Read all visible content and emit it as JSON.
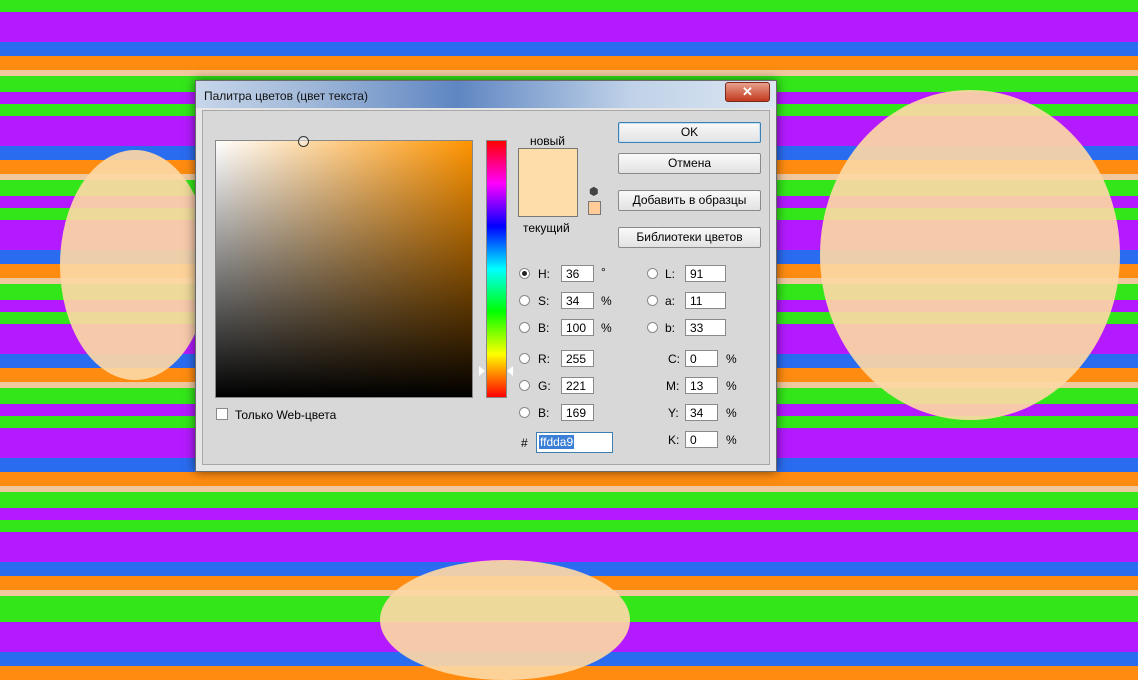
{
  "dialog": {
    "title": "Палитра цветов (цвет текста)",
    "close_label": "✕"
  },
  "preview": {
    "new_label": "новый",
    "current_label": "текущий",
    "new_color": "#ffdda9",
    "websafe_color": "#ffcc99"
  },
  "buttons": {
    "ok": "OK",
    "cancel": "Отмена",
    "add_to_swatches": "Добавить в образцы",
    "color_libraries": "Библиотеки цветов"
  },
  "hsb": {
    "h_label": "H:",
    "h_value": "36",
    "h_unit": "°",
    "s_label": "S:",
    "s_value": "34",
    "s_unit": "%",
    "b_label": "B:",
    "b_value": "100",
    "b_unit": "%"
  },
  "rgb": {
    "r_label": "R:",
    "r_value": "255",
    "g_label": "G:",
    "g_value": "221",
    "b_label": "B:",
    "b_value": "169"
  },
  "lab": {
    "l_label": "L:",
    "l_value": "91",
    "a_label": "a:",
    "a_value": "11",
    "b_label": "b:",
    "b_value": "33"
  },
  "cmyk": {
    "c_label": "C:",
    "c_value": "0",
    "m_label": "M:",
    "m_value": "13",
    "y_label": "Y:",
    "y_value": "34",
    "k_label": "K:",
    "k_value": "0",
    "unit": "%"
  },
  "hex": {
    "label": "#",
    "value": "ffdda9"
  },
  "web_only": {
    "label": "Только Web-цвета",
    "checked": false
  },
  "selected_mode": "H",
  "field_hue_color": "#ff9400"
}
